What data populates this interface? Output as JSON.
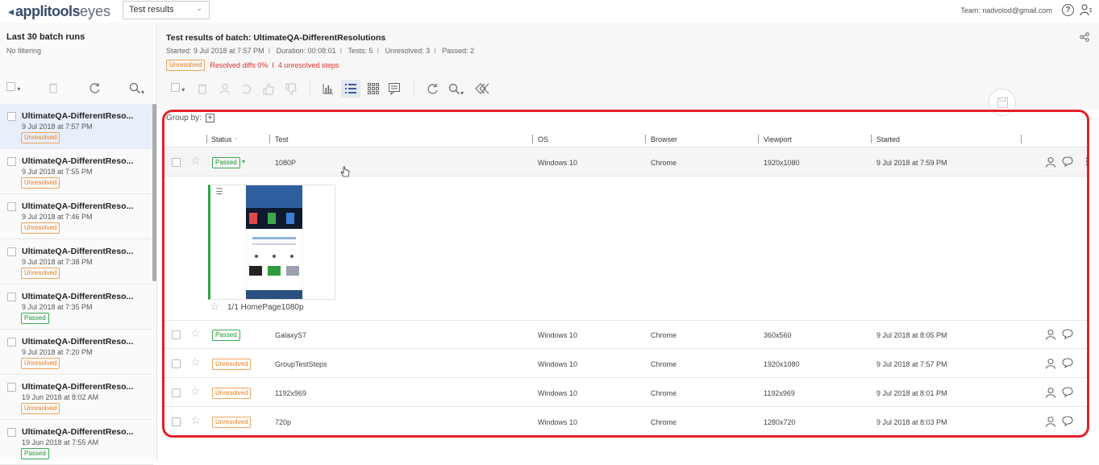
{
  "app": {
    "logo_text": "applitools",
    "logo_suffix": "eyes",
    "view_select": "Test results",
    "team": "Team: nadvolod@gmail.com"
  },
  "left": {
    "title": "Last 30 batch runs",
    "filter": "No filtering",
    "batches": [
      {
        "name": "UltimateQA-DifferentReso...",
        "date": "9 Jul 2018 at 7:57 PM",
        "status": "Unresolved",
        "selected": true
      },
      {
        "name": "UltimateQA-DifferentReso...",
        "date": "9 Jul 2018 at 7:55 PM",
        "status": "Unresolved"
      },
      {
        "name": "UltimateQA-DifferentReso...",
        "date": "9 Jul 2018 at 7:46 PM",
        "status": "Unresolved"
      },
      {
        "name": "UltimateQA-DifferentReso...",
        "date": "9 Jul 2018 at 7:38 PM",
        "status": "Unresolved"
      },
      {
        "name": "UltimateQA-DifferentReso...",
        "date": "9 Jul 2018 at 7:35 PM",
        "status": "Passed"
      },
      {
        "name": "UltimateQA-DifferentReso...",
        "date": "9 Jul 2018 at 7:20 PM",
        "status": "Unresolved"
      },
      {
        "name": "UltimateQA-DifferentReso...",
        "date": "19 Jun 2018 at 8:02 AM",
        "status": "Unresolved"
      },
      {
        "name": "UltimateQA-DifferentReso...",
        "date": "19 Jun 2018 at 7:55 AM",
        "status": "Passed"
      }
    ]
  },
  "main": {
    "title": "Test results of batch:  UltimateQA-DifferentResolutions",
    "meta": [
      "Started: 9 Jul 2018 at 7:57 PM",
      "Duration: 00:08:01",
      "Tests: 5",
      "Unresolved: 3",
      "Passed: 2"
    ],
    "summary_badge": "Unresolved",
    "resolved_diffs": "Resolved diffs 0%",
    "unresolved_steps": "4 unresolved steps",
    "group_by": "Group by:",
    "columns": {
      "status": "Status",
      "test": "Test",
      "os": "OS",
      "browser": "Browser",
      "viewport": "Viewport",
      "started": "Started"
    },
    "rows": [
      {
        "status": "Passed",
        "test": "1080P",
        "os": "Windows 10",
        "browser": "Chrome",
        "viewport": "1920x1080",
        "started": "9 Jul 2018 at 7:59 PM"
      },
      {
        "status": "Passed",
        "test": "GalaxyS7",
        "os": "Windows 10",
        "browser": "Chrome",
        "viewport": "360x560",
        "started": "9 Jul 2018 at 8:05 PM"
      },
      {
        "status": "Unresolved",
        "test": "GroupTestSteps",
        "os": "Windows 10",
        "browser": "Chrome",
        "viewport": "1920x1080",
        "started": "9 Jul 2018 at 7:57 PM"
      },
      {
        "status": "Unresolved",
        "test": "1192x969",
        "os": "Windows 10",
        "browser": "Chrome",
        "viewport": "1192x969",
        "started": "9 Jul 2018 at 8:01 PM"
      },
      {
        "status": "Unresolved",
        "test": "720p",
        "os": "Windows 10",
        "browser": "Chrome",
        "viewport": "1280x720",
        "started": "9 Jul 2018 at 8:03 PM"
      }
    ],
    "expanded_step": "1/1 HomePage1080p"
  },
  "colors": {
    "passed": "#1d9a3a",
    "unresolved": "#ee7d1b",
    "highlight": "#e3202a",
    "accent": "#3b4a6b"
  }
}
